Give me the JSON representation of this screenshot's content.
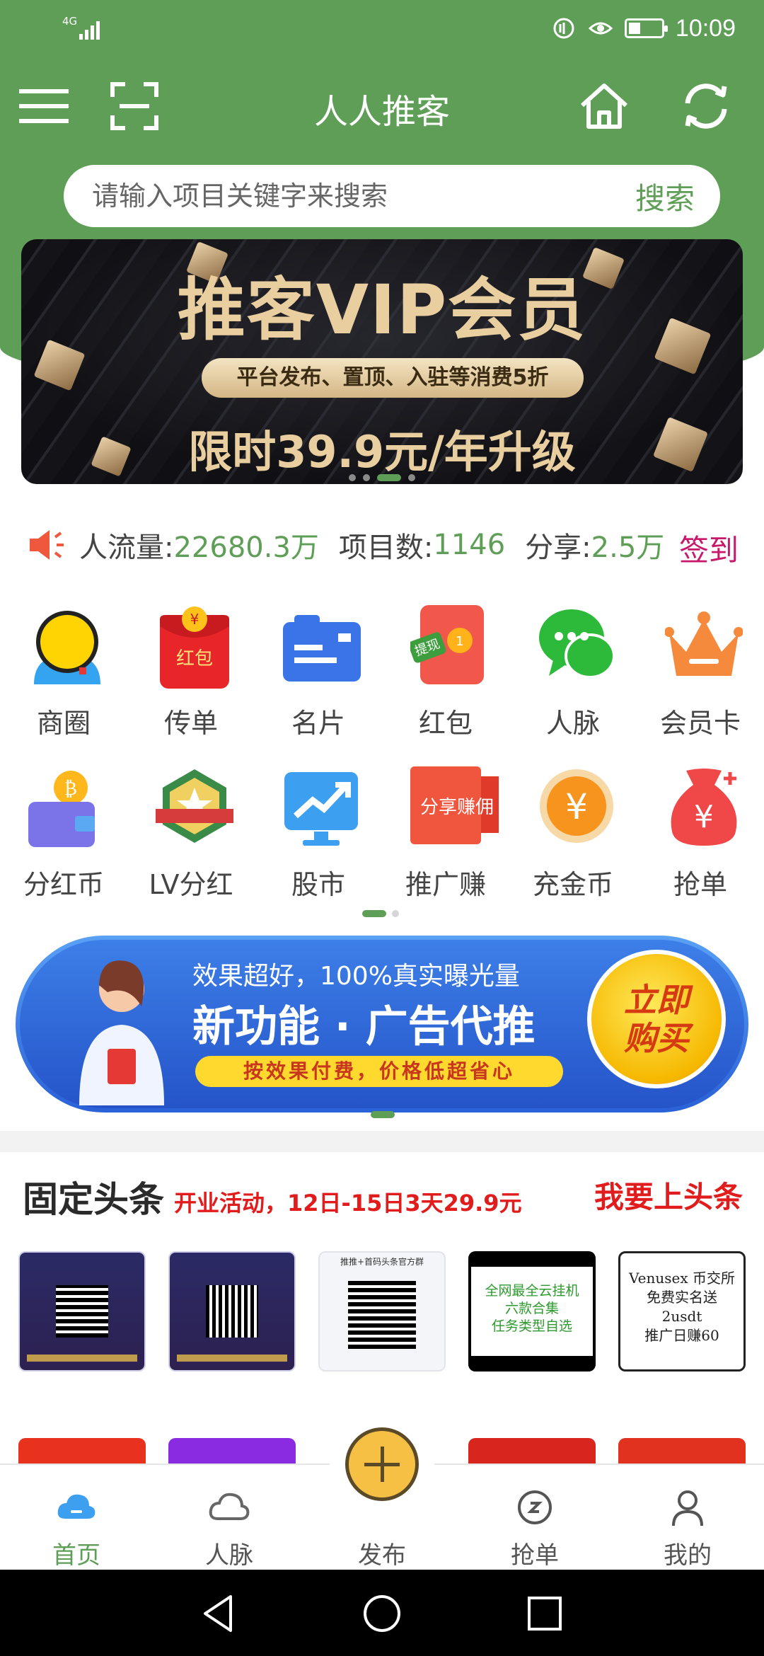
{
  "status_bar": {
    "signal_label": "4G",
    "time": "10:09"
  },
  "header": {
    "title": "人人推客",
    "icons": [
      "menu-icon",
      "scan-icon",
      "home-icon",
      "refresh-icon"
    ]
  },
  "search": {
    "placeholder": "请输入项目关键字来搜索",
    "button_label": "搜索"
  },
  "banner": {
    "title": "推客VIP会员",
    "subtitle": "平台发布、置顶、入驻等消费5折",
    "price_line": "限时39.9元/年升级",
    "slide_count": 4,
    "active_slide": 3
  },
  "stats": {
    "traffic_label": "人流量:",
    "traffic_value": "22680.3万",
    "projects_label": "项目数:",
    "projects_value": "1146",
    "share_label": "分享:",
    "share_value": "2.5万",
    "checkin_label": "签到"
  },
  "grid": [
    {
      "label": "商圈",
      "icon": "business-circle-icon"
    },
    {
      "label": "传单",
      "icon": "red-envelope-flyer-icon",
      "badge": "红包"
    },
    {
      "label": "名片",
      "icon": "business-card-icon"
    },
    {
      "label": "红包",
      "icon": "cash-withdraw-envelope-icon",
      "badge": "提现"
    },
    {
      "label": "人脉",
      "icon": "chat-bubbles-icon"
    },
    {
      "label": "会员卡",
      "icon": "crown-icon"
    },
    {
      "label": "分红币",
      "icon": "wallet-coin-icon"
    },
    {
      "label": "LV分红",
      "icon": "star-badge-icon"
    },
    {
      "label": "股市",
      "icon": "stock-chart-icon"
    },
    {
      "label": "推广赚",
      "icon": "share-earn-icon",
      "badge": "分享赚佣"
    },
    {
      "label": "充金币",
      "icon": "yen-coin-icon"
    },
    {
      "label": "抢单",
      "icon": "money-bag-icon"
    }
  ],
  "promo": {
    "top_line": "效果超好，100%真实曝光量",
    "main_line": "新功能 · 广告代推",
    "pill_text": "按效果付费，价格低超省心",
    "buy_line1": "立即",
    "buy_line2": "购买"
  },
  "headlines": {
    "title": "固定头条",
    "subtitle": "开业活动，12日-15日3天29.9元",
    "action_label": "我要上头条",
    "thumbs": [
      {
        "type": "dark",
        "caption": ""
      },
      {
        "type": "dark",
        "caption": ""
      },
      {
        "type": "light",
        "caption": "推推+首码头条官方群"
      },
      {
        "type": "black",
        "lines": [
          "全网最全云挂机",
          "六款合集",
          "任务类型自选"
        ]
      },
      {
        "type": "white",
        "lines": [
          "Venusex 币交所",
          "免费实名送",
          "2usdt",
          "推广日赚60"
        ]
      }
    ]
  },
  "tabbar": [
    {
      "label": "首页",
      "icon": "home-cloud-icon",
      "active": true
    },
    {
      "label": "人脉",
      "icon": "contacts-cloud-icon",
      "active": false
    },
    {
      "label": "发布",
      "icon": "plus-icon",
      "active": false
    },
    {
      "label": "抢单",
      "icon": "grab-order-icon",
      "active": false
    },
    {
      "label": "我的",
      "icon": "profile-icon",
      "active": false
    }
  ],
  "colors": {
    "brand_green": "#5f9e57",
    "accent_red": "#e11c1c",
    "checkin_magenta": "#c8186c",
    "gold": "#e9cf9f"
  }
}
